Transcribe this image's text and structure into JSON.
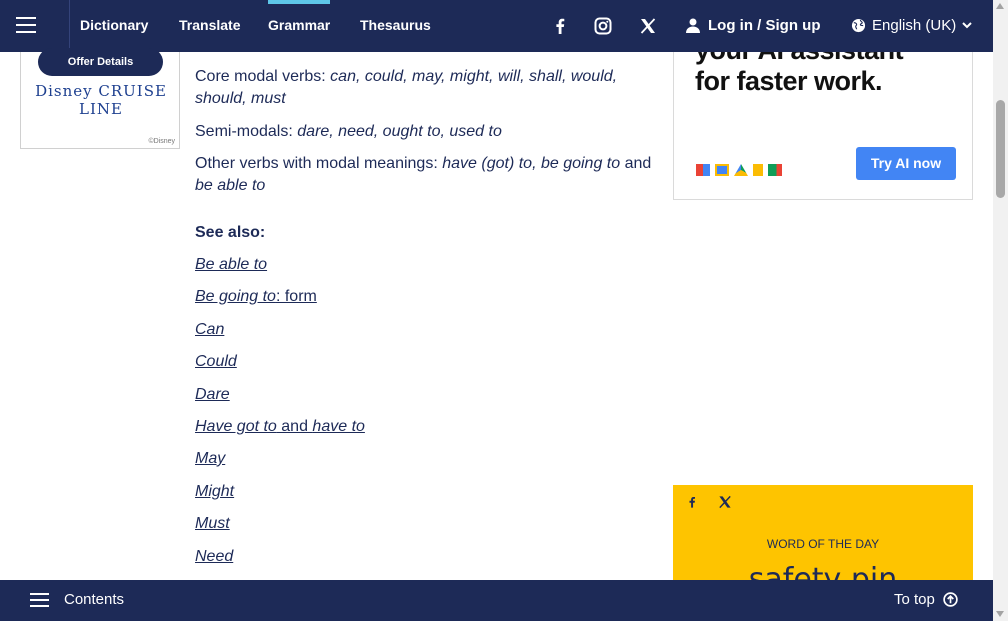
{
  "nav": {
    "links": [
      "Dictionary",
      "Translate",
      "Grammar",
      "Thesaurus"
    ],
    "active": "Grammar",
    "login_label": "Log in / Sign up",
    "language_label": "English (UK)"
  },
  "left_ad": {
    "button_label": "Offer Details",
    "logo_text": "Disney CRUISE LINE",
    "copyright": "©Disney"
  },
  "content": {
    "core_label": "Core modal verbs:",
    "core_items": "can, could, may, might, will, shall, would, should, must",
    "semi_label": "Semi-modals:",
    "semi_items": "dare, need, ought to, used to",
    "other_label": "Other verbs with modal meanings:",
    "other_item1": "have (got) to, be going to",
    "other_and": "and",
    "other_item2": "be able to",
    "see_also_title": "See also:",
    "see_also": {
      "be_able_to": "Be able to",
      "be_going_to": "Be going to",
      "be_going_to_suffix": ": form",
      "can": "Can",
      "could": "Could",
      "dare": "Dare",
      "have_got_to": "Have got to",
      "have_got_to_and": " and ",
      "have_to": "have to",
      "may": "May",
      "might": "Might",
      "must": "Must",
      "need": "Need"
    }
  },
  "right_ad": {
    "headline_line1": "your AI assistant",
    "headline_line2": "for faster work.",
    "cta": "Try AI now",
    "cta_color": "#4285f4"
  },
  "word_of_the_day": {
    "label": "WORD OF THE DAY",
    "word": "safety pin",
    "bg_color": "#fec400"
  },
  "bottom": {
    "contents_label": "Contents",
    "totop_label": "To top"
  },
  "colors": {
    "brand": "#1d2a57",
    "accent": "#5ec6e8"
  }
}
